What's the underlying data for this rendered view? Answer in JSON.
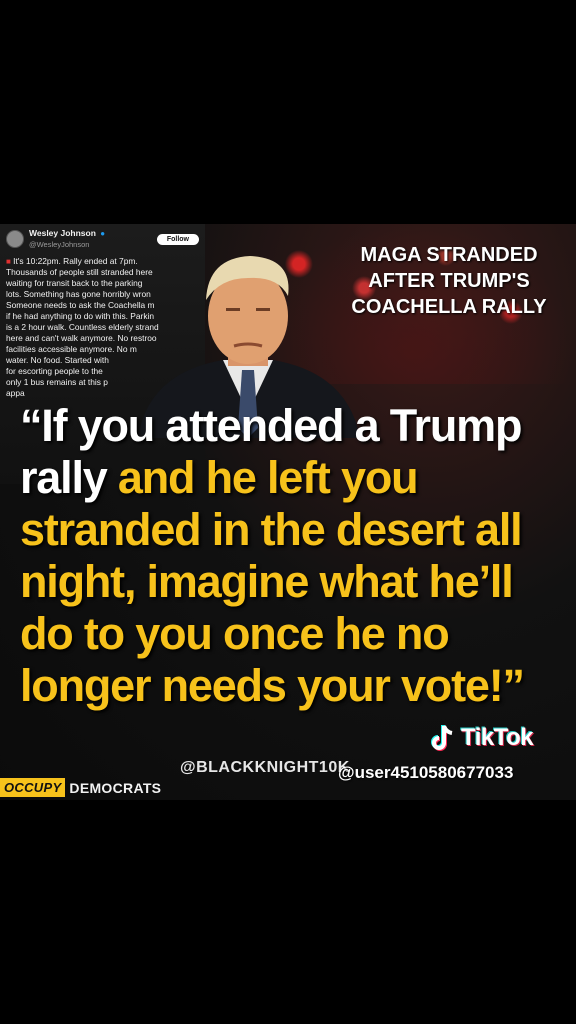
{
  "tweet": {
    "name": "Wesley Johnson",
    "handle": "@WesleyJohnson",
    "follow_label": "Follow",
    "lines": [
      "It's 10:22pm. Rally ended at 7pm.",
      "Thousands of people still stranded here",
      "waiting for transit back to the parking",
      "lots. Something has gone horribly wron",
      "Someone needs to ask the Coachella m",
      "if he had anything to do with this. Parkin",
      "is a 2 hour walk. Countless elderly strand",
      "here and can't walk anymore. No restroo",
      "facilities accessible anymore. No m",
      "water. No food. Started with",
      "for escorting people to the",
      "only 1 bus remains at this p",
      "appa"
    ]
  },
  "headline": [
    "MAGA STRANDED",
    "AFTER TRUMP'S",
    "COACHELLA RALLY"
  ],
  "quote": {
    "line1_white": "“If you attended a Trump",
    "line2_white": "rally ",
    "line2_yellow": "and he left you",
    "line3_yellow": "stranded in the desert all",
    "line4_yellow": "night, imagine what he’ll",
    "line5_yellow": "do to you once he no",
    "line6_yellow": "longer needs your vote!”"
  },
  "credit": "@BLACKKNIGHT10K",
  "brand": {
    "occupy": "OCCUPY",
    "democrats": "DEMOCRATS"
  },
  "tiktok": {
    "word": "TikTok",
    "user": "@user4510580677033"
  },
  "colors": {
    "yellow": "#f7c21b",
    "background": "#000000",
    "tiktok_cyan": "#25f4ee",
    "tiktok_red": "#fe2c55"
  }
}
